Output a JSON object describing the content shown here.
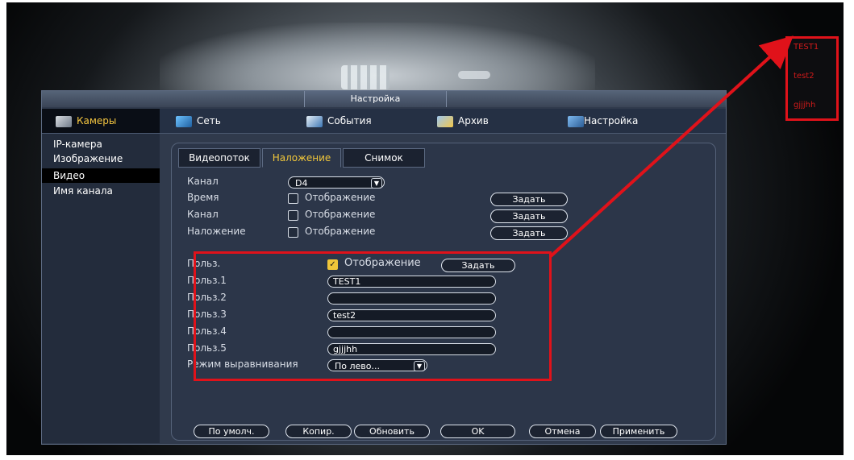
{
  "dialog": {
    "title": "Настройка"
  },
  "topnav": {
    "cameras": "Камеры",
    "network": "Сеть",
    "events": "События",
    "archive": "Архив",
    "settings": "Настройка"
  },
  "sidebar": {
    "items": [
      "IP-камера",
      "Изображение",
      "Видео",
      "Имя канала"
    ],
    "selected": "Видео"
  },
  "tabs": {
    "videostream": "Видеопоток",
    "overlay": "Наложение",
    "snapshot": "Снимок",
    "active": "Наложение"
  },
  "form": {
    "channel_label": "Канал",
    "channel_value": "D4",
    "time_label": "Время",
    "channel2_label": "Канал",
    "overlay_label": "Наложение",
    "display_label": "Отображение",
    "set_label": "Задать",
    "time_display_checked": false,
    "channel_display_checked": false,
    "overlay_display_checked": false
  },
  "custom": {
    "user_label": "Польз.",
    "user_display_checked": true,
    "user_display_label": "Отображение",
    "user_set_label": "Задать",
    "fields": [
      {
        "label": "Польз.1",
        "value": "TEST1"
      },
      {
        "label": "Польз.2",
        "value": ""
      },
      {
        "label": "Польз.3",
        "value": "test2"
      },
      {
        "label": "Польз.4",
        "value": ""
      },
      {
        "label": "Польз.5",
        "value": "gjjjhh"
      }
    ],
    "align_label": "Режим выравнивания",
    "align_value": "По лево..."
  },
  "buttons": {
    "default": "По умолч.",
    "copy": "Копир.",
    "refresh": "Обновить",
    "ok": "OK",
    "cancel": "Отмена",
    "apply": "Применить"
  },
  "overlay_preview": [
    "TEST1",
    "test2",
    "gjjjhh"
  ],
  "colors": {
    "highlight": "#e0121a",
    "accent": "#f0c63a",
    "panel": "#303a4c"
  }
}
